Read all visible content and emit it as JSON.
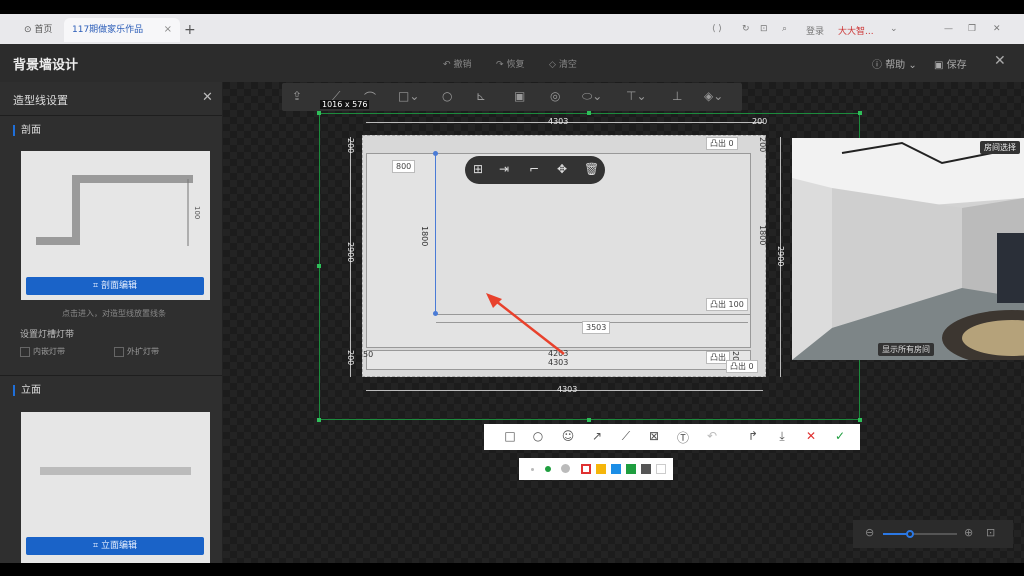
{
  "browser": {
    "home_tab": "首页",
    "active_tab": "117期做家乐作品",
    "tab_close": "×",
    "new_tab": "+",
    "right_items": [
      "登录",
      "大大智..."
    ]
  },
  "header": {
    "title": "背景墙设计",
    "undo": "撤销",
    "redo": "恢复",
    "clear": "清空",
    "help": "帮助",
    "save": "保存",
    "close": "✕"
  },
  "left_panel": {
    "title": "造型线设置",
    "close": "✕",
    "section1": "剖面",
    "section1_dim": "100",
    "section1_button": "剖面编辑",
    "hint": "点击进入，对造型线放置线条",
    "light_title": "设置灯槽灯带",
    "checkbox1": "内嵌灯带",
    "checkbox2": "外扩灯带",
    "section2": "立面",
    "section2_button": "立面编辑"
  },
  "canvas": {
    "size_tag": "1016 x 576",
    "dims": {
      "top_width": "4303",
      "top_right": "200",
      "left_top": "200",
      "left_total": "2900",
      "left_bottom": "200",
      "inner_width": "800",
      "inner_height": "1800",
      "right_height": "1800",
      "far_right_height": "2900",
      "right_top": "200",
      "bottom_inner": "3503",
      "bottom_a": "4203",
      "bottom_b": "4303",
      "bottom_total": "4303",
      "left_small": "50",
      "right_small": "200"
    },
    "labels": {
      "convex_top": "凸出 0",
      "convex_mid": "凸出 100",
      "convex_bottom": "凸出",
      "convex_bottom2": "凸出 0"
    },
    "preview": {
      "room_select": "房间选择",
      "show_all": "显示所有房间"
    }
  },
  "colors": {
    "accent": "#1a63c8",
    "selection": "#1d8a3d",
    "arrow": "#e8412c",
    "palette": [
      "#e03131",
      "#f5b50a",
      "#1c8ee6",
      "#1f9e3f",
      "#555555",
      "#ffffff"
    ]
  }
}
